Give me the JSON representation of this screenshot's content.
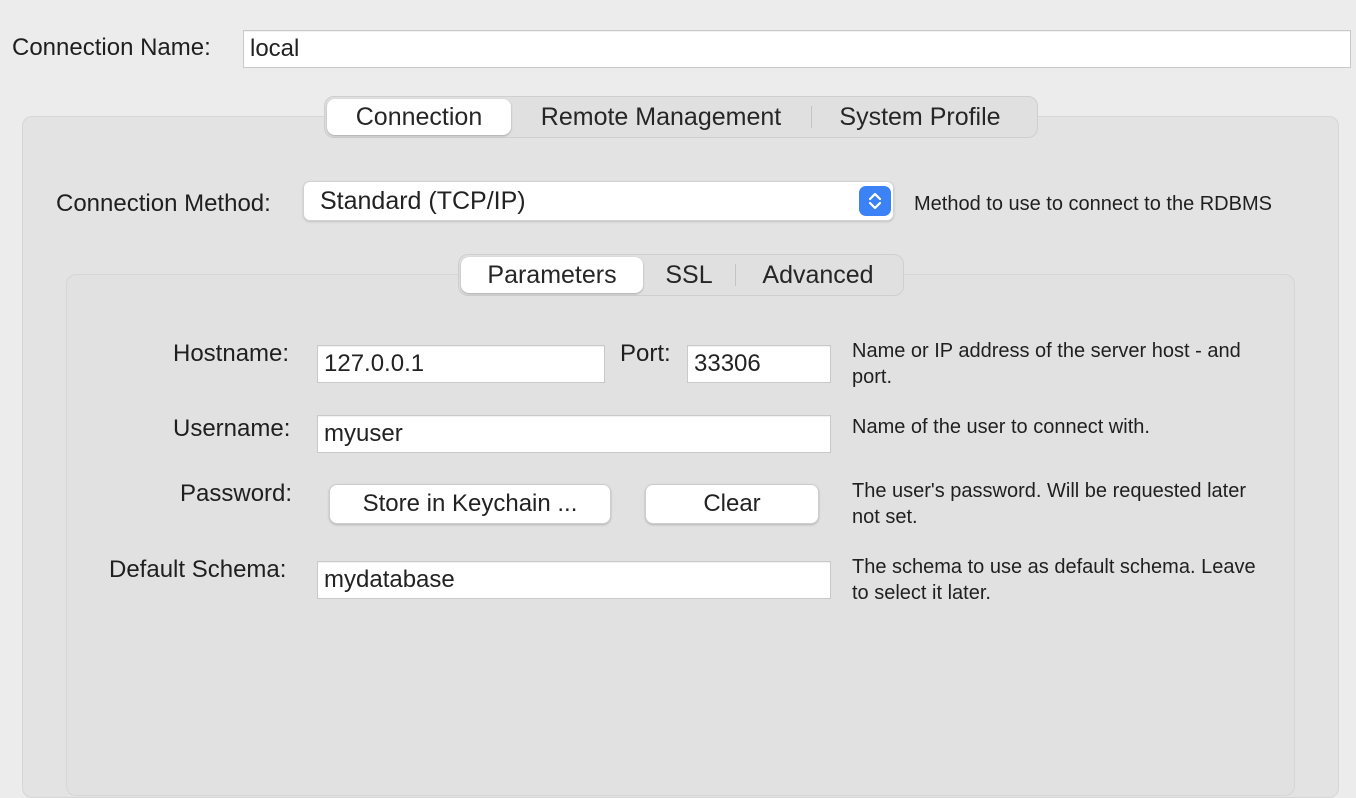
{
  "connection_name": {
    "label": "Connection Name:",
    "value": "local"
  },
  "main_tabs": [
    {
      "label": "Connection",
      "active": true
    },
    {
      "label": "Remote Management",
      "active": false
    },
    {
      "label": "System Profile",
      "active": false
    }
  ],
  "connection_method": {
    "label": "Connection Method:",
    "value": "Standard (TCP/IP)",
    "help": "Method to use to connect to the RDBMS"
  },
  "sub_tabs": [
    {
      "label": "Parameters",
      "active": true
    },
    {
      "label": "SSL",
      "active": false
    },
    {
      "label": "Advanced",
      "active": false
    }
  ],
  "parameters": {
    "hostname": {
      "label": "Hostname:",
      "value": "127.0.0.1"
    },
    "port": {
      "label": "Port:",
      "value": "33306"
    },
    "host_help_line1": "Name or IP address of the server host - and",
    "host_help_line2": "port.",
    "username": {
      "label": "Username:",
      "value": "myuser",
      "help": "Name of the user to connect with."
    },
    "password": {
      "label": "Password:",
      "store_button": "Store in Keychain ...",
      "clear_button": "Clear",
      "help_line1": "The user's password. Will be requested later",
      "help_line2": "not set."
    },
    "default_schema": {
      "label": "Default Schema:",
      "value": "mydatabase",
      "help_line1": "The schema to use as default schema. Leave",
      "help_line2": "to select it later."
    }
  },
  "colors": {
    "window_bg": "#ececec",
    "accent": "#3b82f6",
    "groupbox_bg": "#e3e3e3"
  },
  "icons": {
    "popup_arrows": "chevron-up-down-icon"
  }
}
